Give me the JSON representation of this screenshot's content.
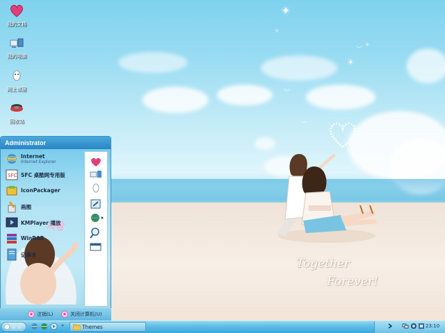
{
  "desktop": {
    "icons": [
      {
        "label": "我的文档",
        "icon": "heart-documents-icon"
      },
      {
        "label": "我的电脑",
        "icon": "computer-icon"
      },
      {
        "label": "网上邻居",
        "icon": "network-icon"
      },
      {
        "label": "回收站",
        "icon": "recycle-bin-icon"
      }
    ]
  },
  "wallpaper": {
    "line1": "Together",
    "line2": "Forever!",
    "badge_text": "사랑"
  },
  "start_menu": {
    "user": "Administrator",
    "items": [
      {
        "title": "Internet",
        "subtitle": "Internet Explorer",
        "icon": "internet-explorer-icon"
      },
      {
        "title": "SFC 桌酷网专用版",
        "icon": "sfc-icon"
      },
      {
        "title": "IconPackager",
        "icon": "iconpackager-icon"
      },
      {
        "title": "画图",
        "icon": "paint-icon"
      },
      {
        "title": "KMPlayer 播放",
        "icon": "kmplayer-icon"
      },
      {
        "title": "WinRAR",
        "icon": "winrar-icon"
      },
      {
        "title": "记事本",
        "icon": "notepad-icon"
      }
    ],
    "right_icons": [
      "my-documents-icon",
      "my-computer-icon",
      "network-icon",
      "control-panel-icon",
      "internet-icon",
      "search-icon",
      "run-icon"
    ],
    "logoff_label": "注销(L)",
    "shutdown_label": "关闭计算机(U)"
  },
  "taskbar": {
    "task_label": "Themes",
    "clock": "23:10"
  },
  "colors": {
    "taskbar_top": "#8ed6f1",
    "taskbar_bottom": "#3ba6da",
    "menu_header": "#2a86c4",
    "accent_pink": "#e0407a"
  }
}
